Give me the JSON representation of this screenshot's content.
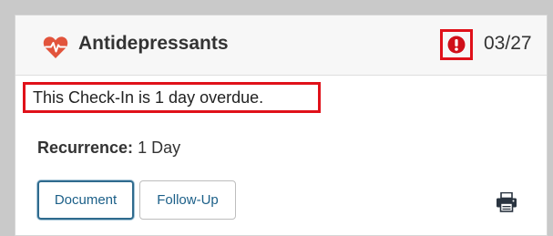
{
  "card": {
    "title": "Antidepressants",
    "date": "03/27",
    "icons": {
      "category": "heart-pulse-icon",
      "alert": "exclamation-circle-icon",
      "print": "printer-icon"
    },
    "overdue_message": "This Check-In is 1 day overdue.",
    "recurrence": {
      "label": "Recurrence:",
      "value": "1 Day"
    },
    "buttons": {
      "document": "Document",
      "follow_up": "Follow-Up"
    }
  },
  "colors": {
    "highlight_border": "#e0111a",
    "heart": "#e2543c",
    "alert": "#d0101a",
    "button_text": "#1b5f88"
  }
}
